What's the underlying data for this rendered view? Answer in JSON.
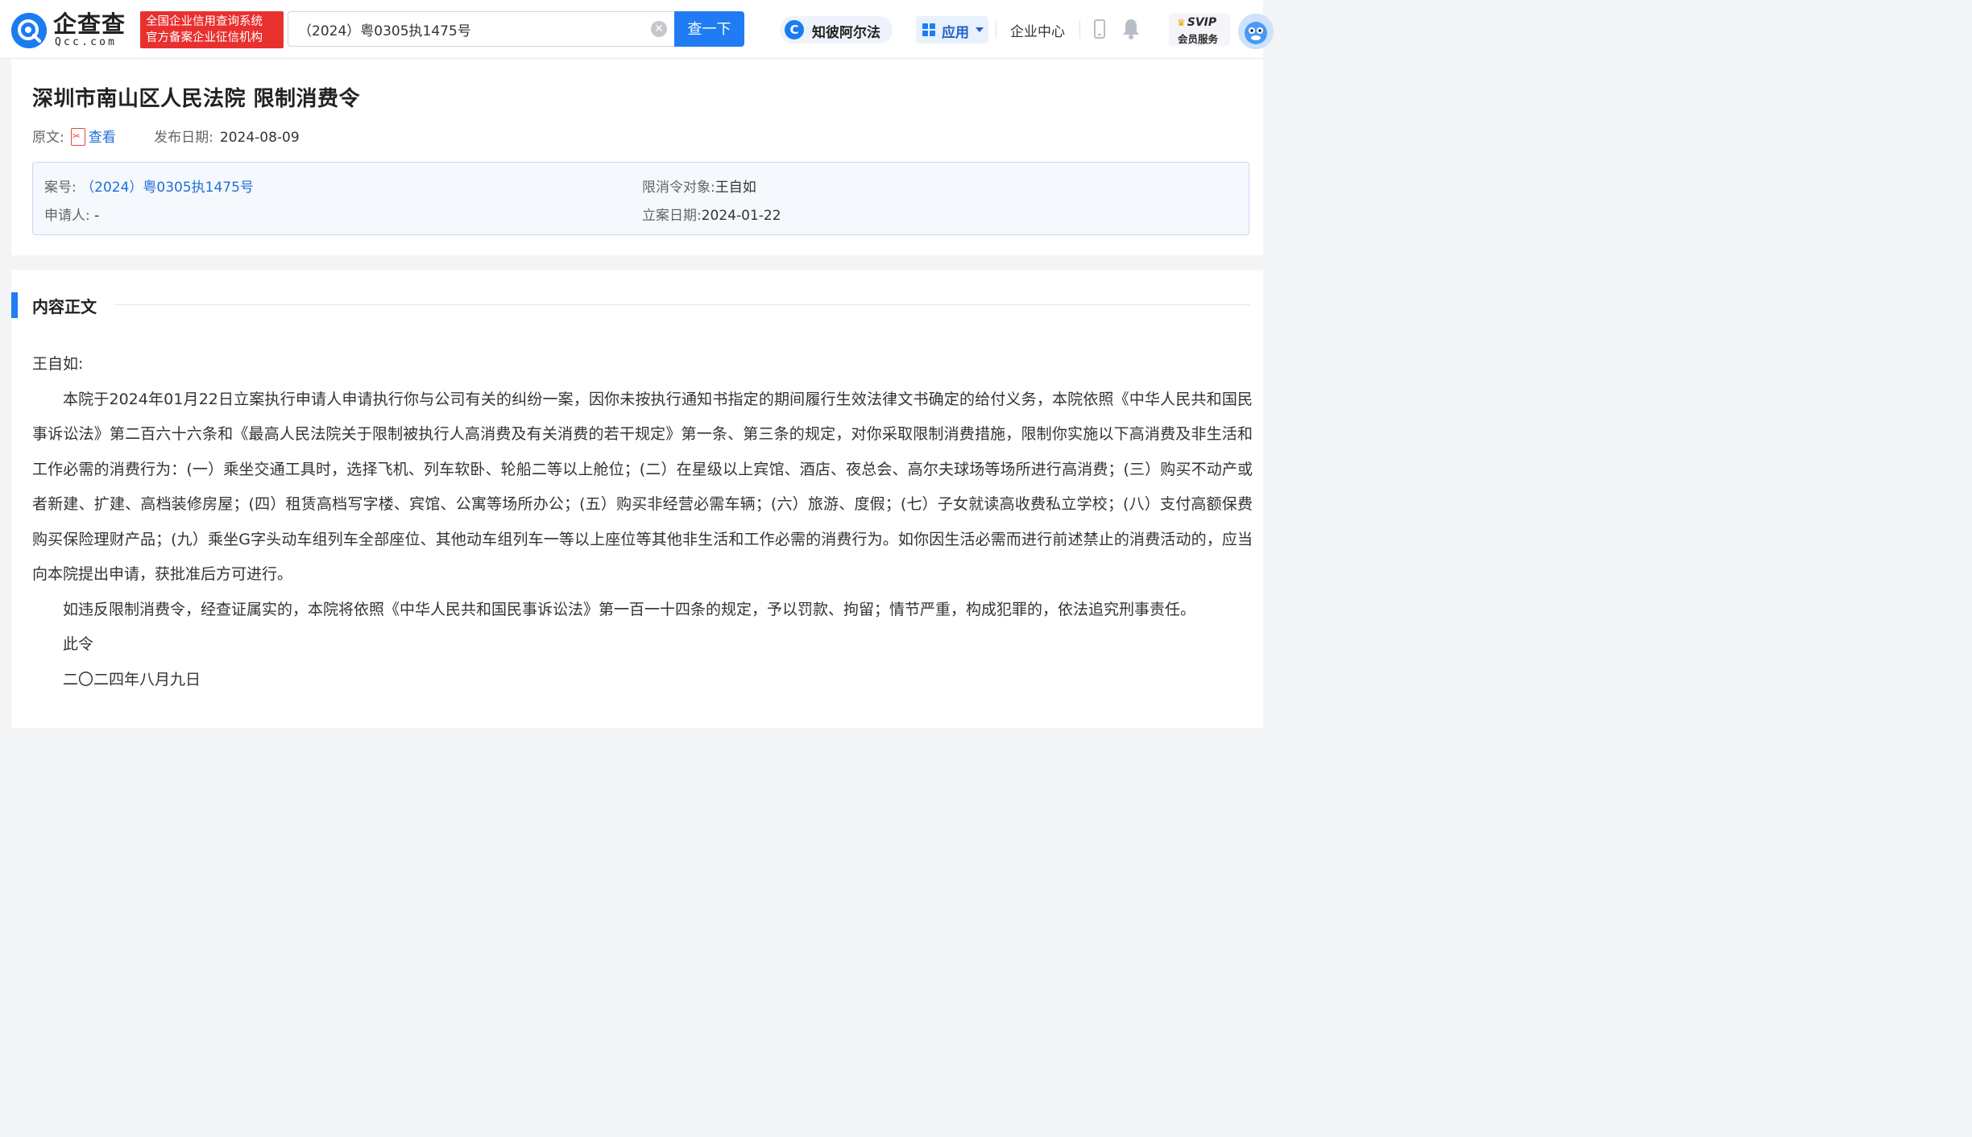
{
  "header": {
    "logo_cn": "企查查",
    "logo_en": "Qcc.com",
    "badge_line1": "全国企业信用查询系统",
    "badge_line2": "官方备案企业征信机构",
    "search_value": "（2024）粤0305执1475号",
    "search_button": "查一下",
    "zhibi_label": "知彼阿尔法",
    "apps_label": "应用",
    "enterprise_label": "企业中心",
    "svip_top": "SVIP",
    "svip_bottom": "会员服务",
    "brand_color": "#1F7CF3",
    "badge_color": "#E8302F"
  },
  "info": {
    "title": "深圳市南山区人民法院 限制消费令",
    "original_label": "原文:",
    "view_link": "查看",
    "publish_label": "发布日期:",
    "publish_date": "2024-08-09",
    "case_no_label": "案号:",
    "case_no": "（2024）粤0305执1475号",
    "applicant_label": "申请人:",
    "applicant": "-",
    "target_label": "限消令对象:",
    "target": "王自如",
    "filing_label": "立案日期:",
    "filing_date": "2024-01-22"
  },
  "content": {
    "section_title": "内容正文",
    "salutation": "王自如:",
    "para1": "本院于2024年01月22日立案执行申请人申请执行你与公司有关的纠纷一案，因你未按执行通知书指定的期间履行生效法律文书确定的给付义务，本院依照《中华人民共和国民事诉讼法》第二百六十六条和《最高人民法院关于限制被执行人高消费及有关消费的若干规定》第一条、第三条的规定，对你采取限制消费措施，限制你实施以下高消费及非生活和工作必需的消费行为：(一）乘坐交通工具时，选择飞机、列车软卧、轮船二等以上舱位；(二）在星级以上宾馆、酒店、夜总会、高尔夫球场等场所进行高消费；(三）购买不动产或者新建、扩建、高档装修房屋；(四）租赁高档写字楼、宾馆、公寓等场所办公；(五）购买非经营必需车辆；(六）旅游、度假；(七）子女就读高收费私立学校；(八）支付高额保费购买保险理财产品；(九）乘坐G字头动车组列车全部座位、其他动车组列车一等以上座位等其他非生活和工作必需的消费行为。如你因生活必需而进行前述禁止的消费活动的，应当向本院提出申请，获批准后方可进行。",
    "para2": "如违反限制消费令，经查证属实的，本院将依照《中华人民共和国民事诉讼法》第一百一十四条的规定，予以罚款、拘留；情节严重，构成犯罪的，依法追究刑事责任。",
    "closing": "此令",
    "date_cn": "二〇二四年八月九日"
  },
  "icons": {
    "logo": "qcc-logo-icon",
    "clear": "clear-icon",
    "zhibi": "zhibi-alpha-icon",
    "apps": "grid-apps-icon",
    "phone": "mobile-phone-icon",
    "bell": "bell-icon",
    "svip": "crown-icon",
    "avatar": "avatar-icon",
    "pdf": "pdf-file-icon"
  }
}
